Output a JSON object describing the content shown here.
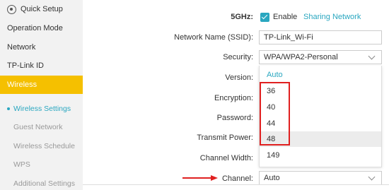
{
  "sidebar": {
    "quick_setup": "Quick Setup",
    "operation_mode": "Operation Mode",
    "network": "Network",
    "tplink_id": "TP-Link ID",
    "wireless": "Wireless",
    "sub": {
      "wireless_settings": "Wireless Settings",
      "guest_network": "Guest Network",
      "wireless_schedule": "Wireless Schedule",
      "wps": "WPS",
      "additional_settings": "Additional Settings"
    }
  },
  "form": {
    "band_label": "5GHz:",
    "enable_label": "Enable",
    "enable_checked": true,
    "sharing_link": "Sharing Network",
    "ssid_label": "Network Name (SSID):",
    "ssid_value": "TP-Link_Wi-Fi",
    "security_label": "Security:",
    "security_value": "WPA/WPA2-Personal",
    "version_label": "Version:",
    "encryption_label": "Encryption:",
    "password_label": "Password:",
    "transmit_label": "Transmit Power:",
    "channel_width_label": "Channel Width:",
    "channel_label": "Channel:",
    "channel_value": "Auto"
  },
  "dropdown": {
    "options": [
      "Auto",
      "36",
      "40",
      "44",
      "48",
      "149"
    ],
    "selected": "Auto",
    "highlighted": "48"
  },
  "colors": {
    "accent": "#2aa7c0",
    "active_nav": "#f5c000",
    "annotation": "#e02020"
  }
}
